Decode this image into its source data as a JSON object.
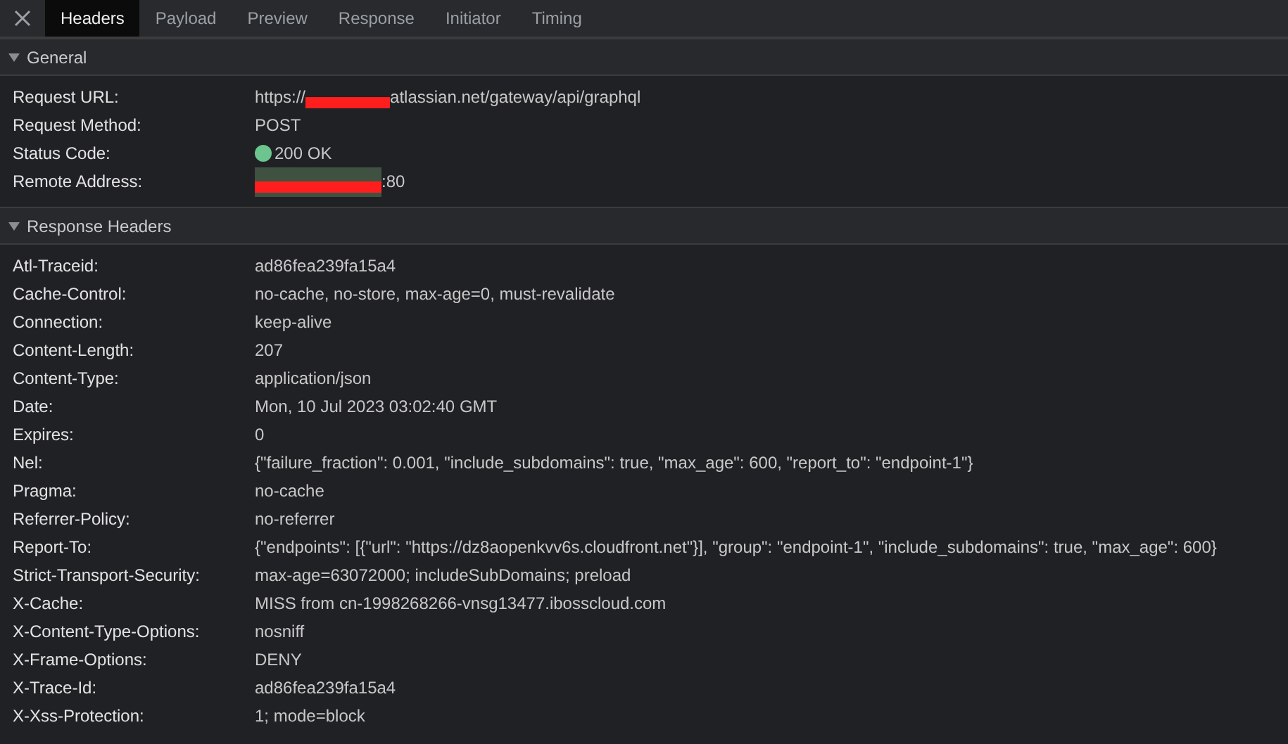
{
  "tabs": [
    {
      "label": "Headers",
      "selected": true
    },
    {
      "label": "Payload",
      "selected": false
    },
    {
      "label": "Preview",
      "selected": false
    },
    {
      "label": "Response",
      "selected": false
    },
    {
      "label": "Initiator",
      "selected": false
    },
    {
      "label": "Timing",
      "selected": false
    }
  ],
  "sections": [
    {
      "title": "General",
      "expanded": true,
      "rows": [
        {
          "name": "Request URL:",
          "value_start": "https://",
          "redacted": true,
          "value": "atlassian.net/gateway/api/graphql"
        },
        {
          "name": "Request Method:",
          "value": "POST"
        },
        {
          "name": "Status Code:",
          "color": "#6cc58e",
          "value": "200 OK"
        },
        {
          "name": "Remote Address:",
          "redacted": true,
          "highlighted": true,
          "value": ":80"
        }
      ]
    },
    {
      "title": "Response Headers",
      "expanded": true,
      "rows": [
        {
          "name": "Atl-Traceid:",
          "value": "ad86fea239fa15a4"
        },
        {
          "name": "Cache-Control:",
          "value": "no-cache, no-store, max-age=0, must-revalidate"
        },
        {
          "name": "Connection:",
          "value": "keep-alive"
        },
        {
          "name": "Content-Length:",
          "value": "207"
        },
        {
          "name": "Content-Type:",
          "value": "application/json"
        },
        {
          "name": "Date:",
          "value": "Mon, 10 Jul 2023 03:02:40 GMT"
        },
        {
          "name": "Expires:",
          "value": "0"
        },
        {
          "name": "Nel:",
          "value": "{\"failure_fraction\": 0.001, \"include_subdomains\": true, \"max_age\": 600, \"report_to\": \"endpoint-1\"}"
        },
        {
          "name": "Pragma:",
          "value": "no-cache"
        },
        {
          "name": "Referrer-Policy:",
          "value": "no-referrer"
        },
        {
          "name": "Report-To:",
          "value": "{\"endpoints\": [{\"url\": \"https://dz8aopenkvv6s.cloudfront.net\"}], \"group\": \"endpoint-1\", \"include_subdomains\": true, \"max_age\": 600}"
        },
        {
          "name": "Strict-Transport-Security:",
          "value": "max-age=63072000; includeSubDomains; preload"
        },
        {
          "name": "X-Cache:",
          "value": "MISS from cn-1998268266-vnsg13477.ibosscloud.com"
        },
        {
          "name": "X-Content-Type-Options:",
          "value": "nosniff"
        },
        {
          "name": "X-Frame-Options:",
          "value": "DENY"
        },
        {
          "name": "X-Trace-Id:",
          "value": "ad86fea239fa15a4"
        },
        {
          "name": "X-Xss-Protection:",
          "value": "1; mode=block"
        }
      ]
    }
  ]
}
